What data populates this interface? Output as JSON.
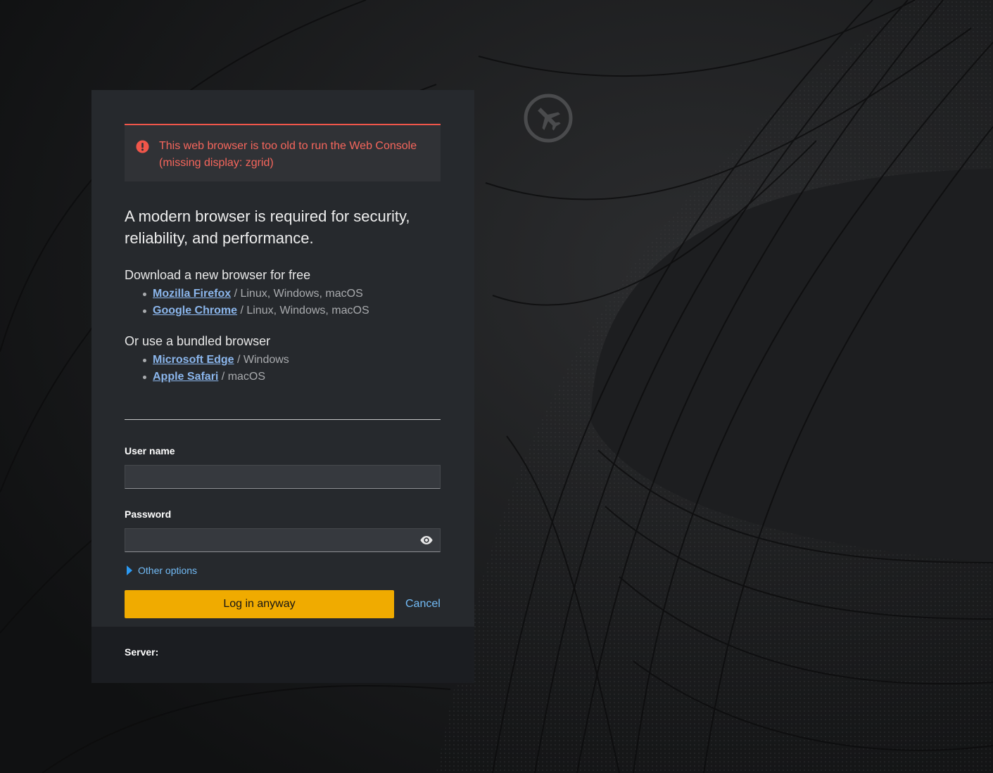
{
  "alert": {
    "message": "This web browser is too old to run the Web Console (missing display: zgrid)",
    "icon": "exclamation-circle-icon"
  },
  "browser_notice": {
    "lead": "A modern browser is required for security, reliability, and performance.",
    "download_title": "Download a new browser for free",
    "download_browsers": [
      {
        "name": "Mozilla Firefox",
        "platforms": " / Linux, Windows, macOS"
      },
      {
        "name": "Google Chrome",
        "platforms": " / Linux, Windows, macOS"
      }
    ],
    "bundled_title": "Or use a bundled browser",
    "bundled_browsers": [
      {
        "name": "Microsoft Edge",
        "platforms": " / Windows"
      },
      {
        "name": "Apple Safari",
        "platforms": " / macOS"
      }
    ]
  },
  "login": {
    "username_label": "User name",
    "username_value": "",
    "password_label": "Password",
    "password_value": "",
    "other_options": "Other options",
    "login_button": "Log in anyway",
    "cancel_button": "Cancel"
  },
  "footer": {
    "server_label": "Server:"
  },
  "colors": {
    "card": "#26292d",
    "footer": "#1b1d21",
    "alert_red": "#f0564a",
    "link": "#8bb6ec",
    "primary_button": "#f0ab00"
  }
}
